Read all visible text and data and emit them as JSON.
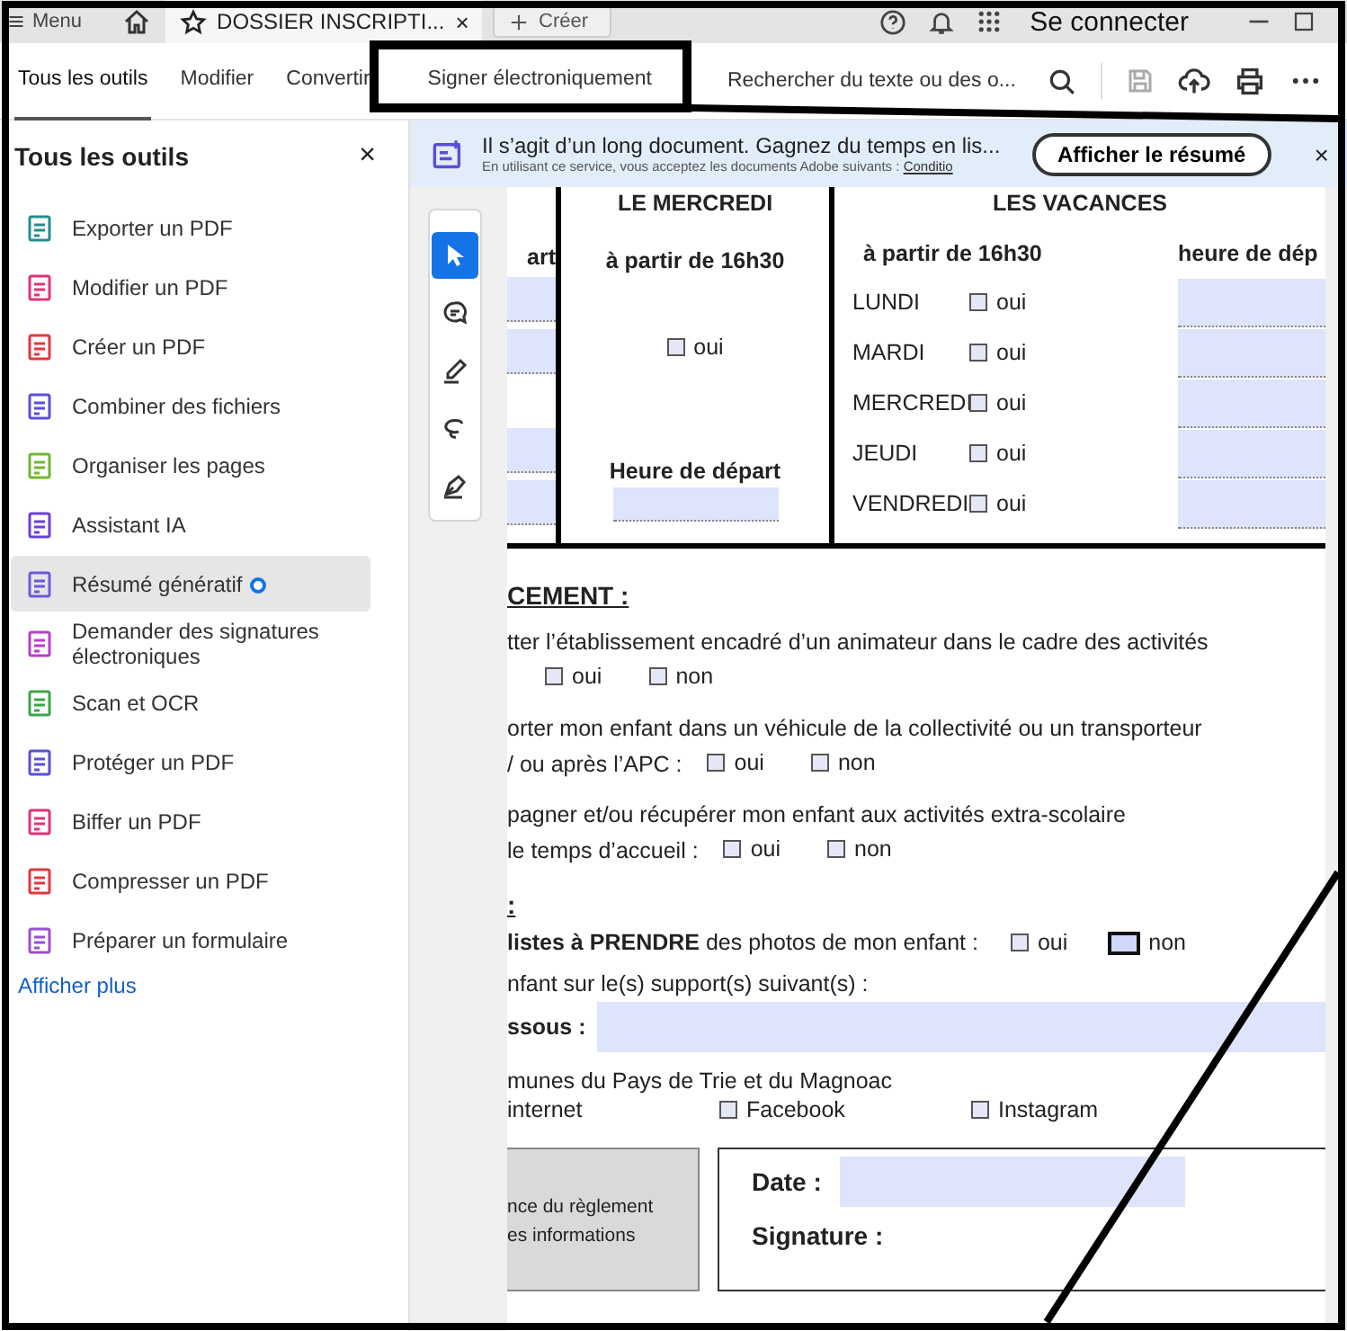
{
  "browser": {
    "menu": "Menu",
    "tab_title": "DOSSIER INSCRIPTI...",
    "tab_close": "×",
    "new_tab": "Créer",
    "sign_in": "Se connecter"
  },
  "toolbar": {
    "tabs": [
      {
        "label": "Tous les outils",
        "selected": true
      },
      {
        "label": "Modifier",
        "selected": false
      },
      {
        "label": "Convertir",
        "selected": false
      },
      {
        "label": "Signer électroniquement",
        "selected": false
      }
    ],
    "search": {
      "placeholder": "Rechercher du texte ou des o..."
    }
  },
  "tools_panel": {
    "title": "Tous les outils",
    "close": "×",
    "items": [
      {
        "label": "Exporter un PDF",
        "color": "#1f8f8f",
        "selected": false,
        "badge": false
      },
      {
        "label": "Modifier un PDF",
        "color": "#e0337a",
        "selected": false,
        "badge": false
      },
      {
        "label": "Créer un PDF",
        "color": "#e0383e",
        "selected": false,
        "badge": false
      },
      {
        "label": "Combiner des fichiers",
        "color": "#5a4fd6",
        "selected": false,
        "badge": false
      },
      {
        "label": "Organiser les pages",
        "color": "#6fb82f",
        "selected": false,
        "badge": false
      },
      {
        "label": "Assistant IA",
        "color": "#6b3fd8",
        "selected": false,
        "badge": false
      },
      {
        "label": "Résumé génératif",
        "color": "#6b5ad8",
        "selected": true,
        "badge": true
      },
      {
        "label": "Demander des signatures électroniques",
        "color": "#b83fc8",
        "selected": false,
        "badge": false
      },
      {
        "label": "Scan et OCR",
        "color": "#3aa548",
        "selected": false,
        "badge": false
      },
      {
        "label": "Protéger un PDF",
        "color": "#5a4fd6",
        "selected": false,
        "badge": false
      },
      {
        "label": "Biffer un PDF",
        "color": "#e0337a",
        "selected": false,
        "badge": false
      },
      {
        "label": "Compresser un PDF",
        "color": "#e0383e",
        "selected": false,
        "badge": false
      },
      {
        "label": "Préparer un formulaire",
        "color": "#9a4fd0",
        "selected": false,
        "badge": false
      }
    ],
    "more": "Afficher plus"
  },
  "banner": {
    "message": "Il s’agit d’un long document. Gagnez du temps en lis...",
    "note": "En utilisant ce service, vous acceptez les documents Adobe suivants :",
    "link": "Conditio",
    "button": "Afficher le résumé",
    "close": "×"
  },
  "edit_tools": [
    {
      "kind": "select",
      "selected": true
    },
    {
      "kind": "comment",
      "selected": false
    },
    {
      "kind": "highlight",
      "selected": false
    },
    {
      "kind": "draw",
      "selected": false
    },
    {
      "kind": "sign",
      "selected": false
    }
  ],
  "document": {
    "schedule": {
      "column_1": {
        "header": "art"
      },
      "wednesday": {
        "title": "LE MERCREDI",
        "subtitle": "à partir de 16h30",
        "option": {
          "label": "oui",
          "checked": false,
          "highlighted": false
        },
        "departure_label": "Heure de départ"
      },
      "holidays": {
        "title": "LES VACANCES",
        "subtitle": "à partir de 16h30",
        "column_3_header": "heure de dép",
        "days": [
          {
            "day": "LUNDI",
            "label": "oui",
            "checked": false,
            "highlighted": false
          },
          {
            "day": "MARDI",
            "label": "oui",
            "checked": false,
            "highlighted": false
          },
          {
            "day": "MERCREDI",
            "label": "oui",
            "checked": false,
            "highlighted": false
          },
          {
            "day": "JEUDI",
            "label": "oui",
            "checked": false,
            "highlighted": false
          },
          {
            "day": "VENDREDI",
            "label": "oui",
            "checked": false,
            "highlighted": false
          }
        ]
      }
    },
    "heading_1": "CEMENT :",
    "questions": [
      {
        "line_1": "tter l’établissement encadré d’un animateur dans le cadre des activités",
        "options": [
          {
            "label": "oui",
            "checked": false,
            "highlighted": false
          },
          {
            "label": "non",
            "checked": false,
            "highlighted": false
          }
        ]
      },
      {
        "line_1": "orter mon enfant dans un véhicule de la collectivité ou un transporteur",
        "line_2": "/ ou après l’APC :",
        "options": [
          {
            "label": "oui",
            "checked": false,
            "highlighted": false
          },
          {
            "label": "non",
            "checked": false,
            "highlighted": false
          }
        ]
      },
      {
        "line_1": "pagner et/ou récupérer mon enfant aux activités extra-scolaire",
        "line_2": "le temps d’accueil :",
        "options": [
          {
            "label": "oui",
            "checked": false,
            "highlighted": false
          },
          {
            "label": "non",
            "checked": false,
            "highlighted": false
          }
        ]
      }
    ],
    "heading_2": ":",
    "photo": {
      "text": "**listes à PRENDRE** des photos de mon enfant :",
      "options": [
        {
          "label": "oui",
          "checked": false,
          "highlighted": false
        },
        {
          "label": "non",
          "checked": false,
          "highlighted": true
        }
      ]
    },
    "support": {
      "text": "nfant sur le(s) support(s) suivant(s) :",
      "field_label": "ssous :"
    },
    "communes": {
      "text": "munes du Pays de Trie et du Magnoac",
      "first": "internet",
      "options": [
        {
          "label": "Facebook",
          "checked": false,
          "highlighted": false
        },
        {
          "label": "Instagram",
          "checked": false,
          "highlighted": false
        }
      ]
    },
    "footer": {
      "notice_lines": [
        "nce du règlement",
        "es informations"
      ],
      "date_label": "Date :",
      "signature_label": "Signature :"
    }
  }
}
